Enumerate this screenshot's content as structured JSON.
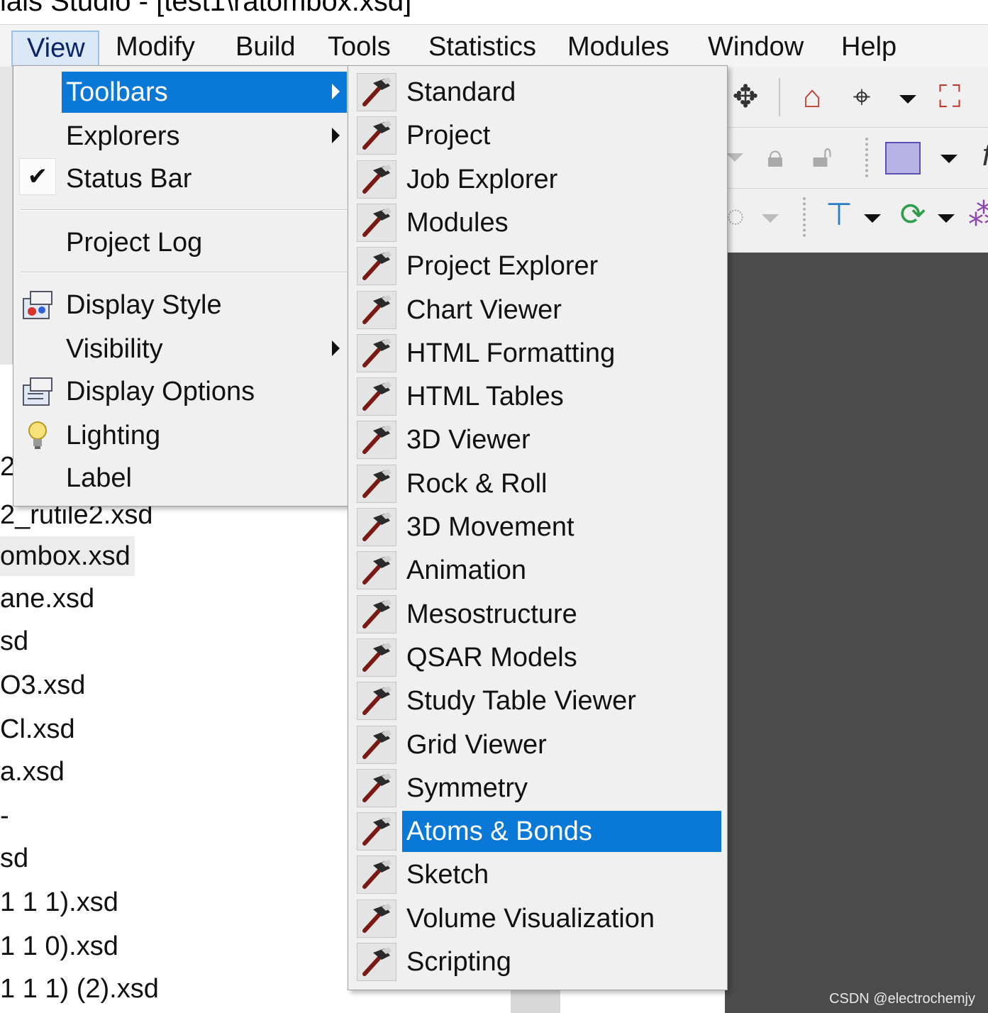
{
  "window": {
    "title_fragment": "ials Studio - [test1\\ratombox.xsd]"
  },
  "menubar": {
    "items": [
      "View",
      "Modify",
      "Build",
      "Tools",
      "Statistics",
      "Modules",
      "Window",
      "Help"
    ],
    "active": "View"
  },
  "view_menu": {
    "toolbars": "Toolbars",
    "explorers": "Explorers",
    "status_bar": "Status Bar",
    "status_bar_checked": true,
    "project_log": "Project Log",
    "display_style": "Display Style",
    "visibility": "Visibility",
    "display_options": "Display Options",
    "lighting": "Lighting",
    "label": "Label"
  },
  "toolbars_submenu": {
    "items": [
      "Standard",
      "Project",
      "Job Explorer",
      "Modules",
      "Project Explorer",
      "Chart Viewer",
      "HTML Formatting",
      "HTML Tables",
      "3D Viewer",
      "Rock & Roll",
      "3D Movement",
      "Animation",
      "Mesostructure",
      "QSAR Models",
      "Study Table Viewer",
      "Grid Viewer",
      "Symmetry",
      "Atoms & Bonds",
      "Sketch",
      "Volume Visualization",
      "Scripting"
    ],
    "highlighted": "Atoms & Bonds"
  },
  "explorer_files": {
    "items": [
      "2",
      "2_rutile2.xsd",
      "ombox.xsd",
      "ane.xsd",
      "sd",
      "O3.xsd",
      "Cl.xsd",
      "a.xsd",
      "-",
      "sd",
      "1 1 1).xsd",
      "1 1 0).xsd",
      "1 1 1) (2).xsd"
    ],
    "selected": "ombox.xsd"
  },
  "toolbar_icons": [
    "move-icon",
    "home-icon",
    "crosshair-icon",
    "fit-view-icon",
    "lock-icon",
    "unlock-icon",
    "grid-select-icon",
    "function-icon",
    "align-icon",
    "rotate-icon",
    "molecule-icon"
  ],
  "colors": {
    "highlight": "#0a78d7",
    "viewport": "#4b4b4b"
  },
  "watermark": "CSDN @electrochemjy"
}
